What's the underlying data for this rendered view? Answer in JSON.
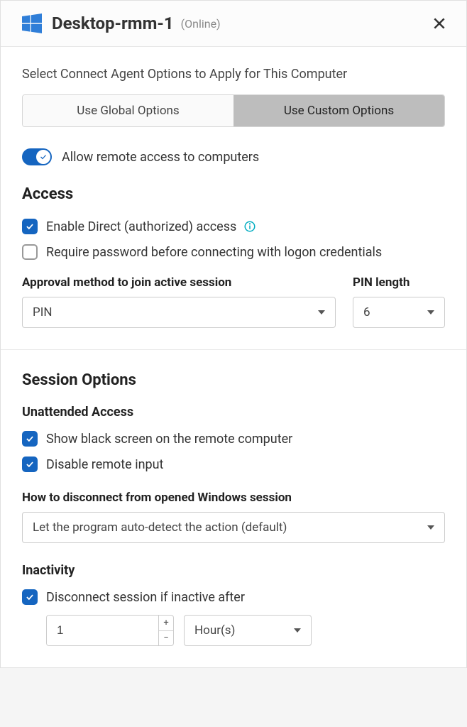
{
  "header": {
    "title": "Desktop-rmm-1",
    "status": "(Online)"
  },
  "intro": "Select Connect Agent Options to Apply for This Computer",
  "segments": {
    "global": "Use Global Options",
    "custom": "Use Custom Options"
  },
  "allow_remote_label": "Allow remote access to computers",
  "access": {
    "title": "Access",
    "enable_direct": "Enable Direct (authorized) access",
    "require_password": "Require password before connecting with logon credentials",
    "approval_label": "Approval method to join active session",
    "approval_value": "PIN",
    "pin_label": "PIN length",
    "pin_value": "6"
  },
  "session": {
    "title": "Session Options",
    "unattended_title": "Unattended Access",
    "black_screen": "Show black screen on the remote computer",
    "disable_input": "Disable remote input",
    "disconnect_label": "How to disconnect from opened Windows session",
    "disconnect_value": "Let the program auto-detect the action (default)",
    "inactivity_title": "Inactivity",
    "inactivity_check": "Disconnect session if inactive after",
    "inactivity_value": "1",
    "inactivity_unit": "Hour(s)"
  }
}
